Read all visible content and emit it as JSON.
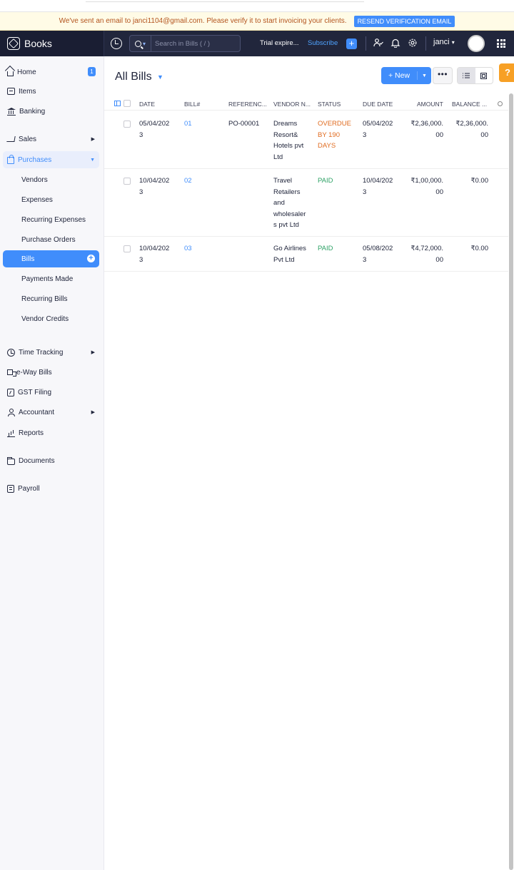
{
  "banner": {
    "message": "We've sent an email to janci1104@gmail.com. Please verify it to start invoicing your clients.",
    "button": "RESEND VERIFICATION EMAIL"
  },
  "topbar": {
    "app_name": "Books",
    "search_placeholder": "Search in Bills ( / )",
    "trial": "Trial expire...",
    "subscribe": "Subscribe",
    "user": "janci"
  },
  "sidebar": {
    "home": "Home",
    "home_badge": "1",
    "items": "Items",
    "banking": "Banking",
    "sales": "Sales",
    "purchases": "Purchases",
    "vendors": "Vendors",
    "expenses": "Expenses",
    "recurring_expenses": "Recurring Expenses",
    "purchase_orders": "Purchase Orders",
    "bills": "Bills",
    "payments_made": "Payments Made",
    "recurring_bills": "Recurring Bills",
    "vendor_credits": "Vendor Credits",
    "time_tracking": "Time Tracking",
    "eway_bills": "e-Way Bills",
    "gst_filing": "GST Filing",
    "accountant": "Accountant",
    "reports": "Reports",
    "documents": "Documents",
    "payroll": "Payroll"
  },
  "main": {
    "title": "All Bills",
    "new_button": "+ New",
    "help": "?"
  },
  "table": {
    "columns": [
      "DATE",
      "BILL#",
      "REFERENC...",
      "VENDOR N...",
      "STATUS",
      "DUE DATE",
      "AMOUNT",
      "BALANCE ..."
    ],
    "rows": [
      {
        "date": [
          "05/04/202",
          "3"
        ],
        "bill": "01",
        "reference": "PO-00001",
        "vendor": [
          "Dreams",
          "Resort&",
          "Hotels pvt",
          "Ltd"
        ],
        "status": [
          "OVERDUE",
          "BY 190",
          "DAYS"
        ],
        "due": [
          "05/04/202",
          "3"
        ],
        "amount": [
          "₹2,36,000.",
          "00"
        ],
        "balance": [
          "₹2,36,000.",
          "00"
        ]
      },
      {
        "date": [
          "10/04/202",
          "3"
        ],
        "bill": "02",
        "reference": "",
        "vendor": [
          "Travel",
          "Retailers",
          "and",
          "wholesaler",
          "s pvt Ltd"
        ],
        "status": [
          "PAID"
        ],
        "due": [
          "10/04/202",
          "3"
        ],
        "amount": [
          "₹1,00,000.",
          "00"
        ],
        "balance": [
          "₹0.00"
        ]
      },
      {
        "date": [
          "10/04/202",
          "3"
        ],
        "bill": "03",
        "reference": "",
        "vendor": [
          "Go Airlines",
          "Pvt Ltd"
        ],
        "status": [
          "PAID"
        ],
        "due": [
          "05/08/202",
          "3"
        ],
        "amount": [
          "₹4,72,000.",
          "00"
        ],
        "balance": [
          "₹0.00"
        ]
      }
    ]
  },
  "colors": {
    "accent": "#408dfb",
    "topbar": "#21263c",
    "overdue": "#e06b1f",
    "paid": "#2ea266",
    "help": "#f7a025"
  }
}
